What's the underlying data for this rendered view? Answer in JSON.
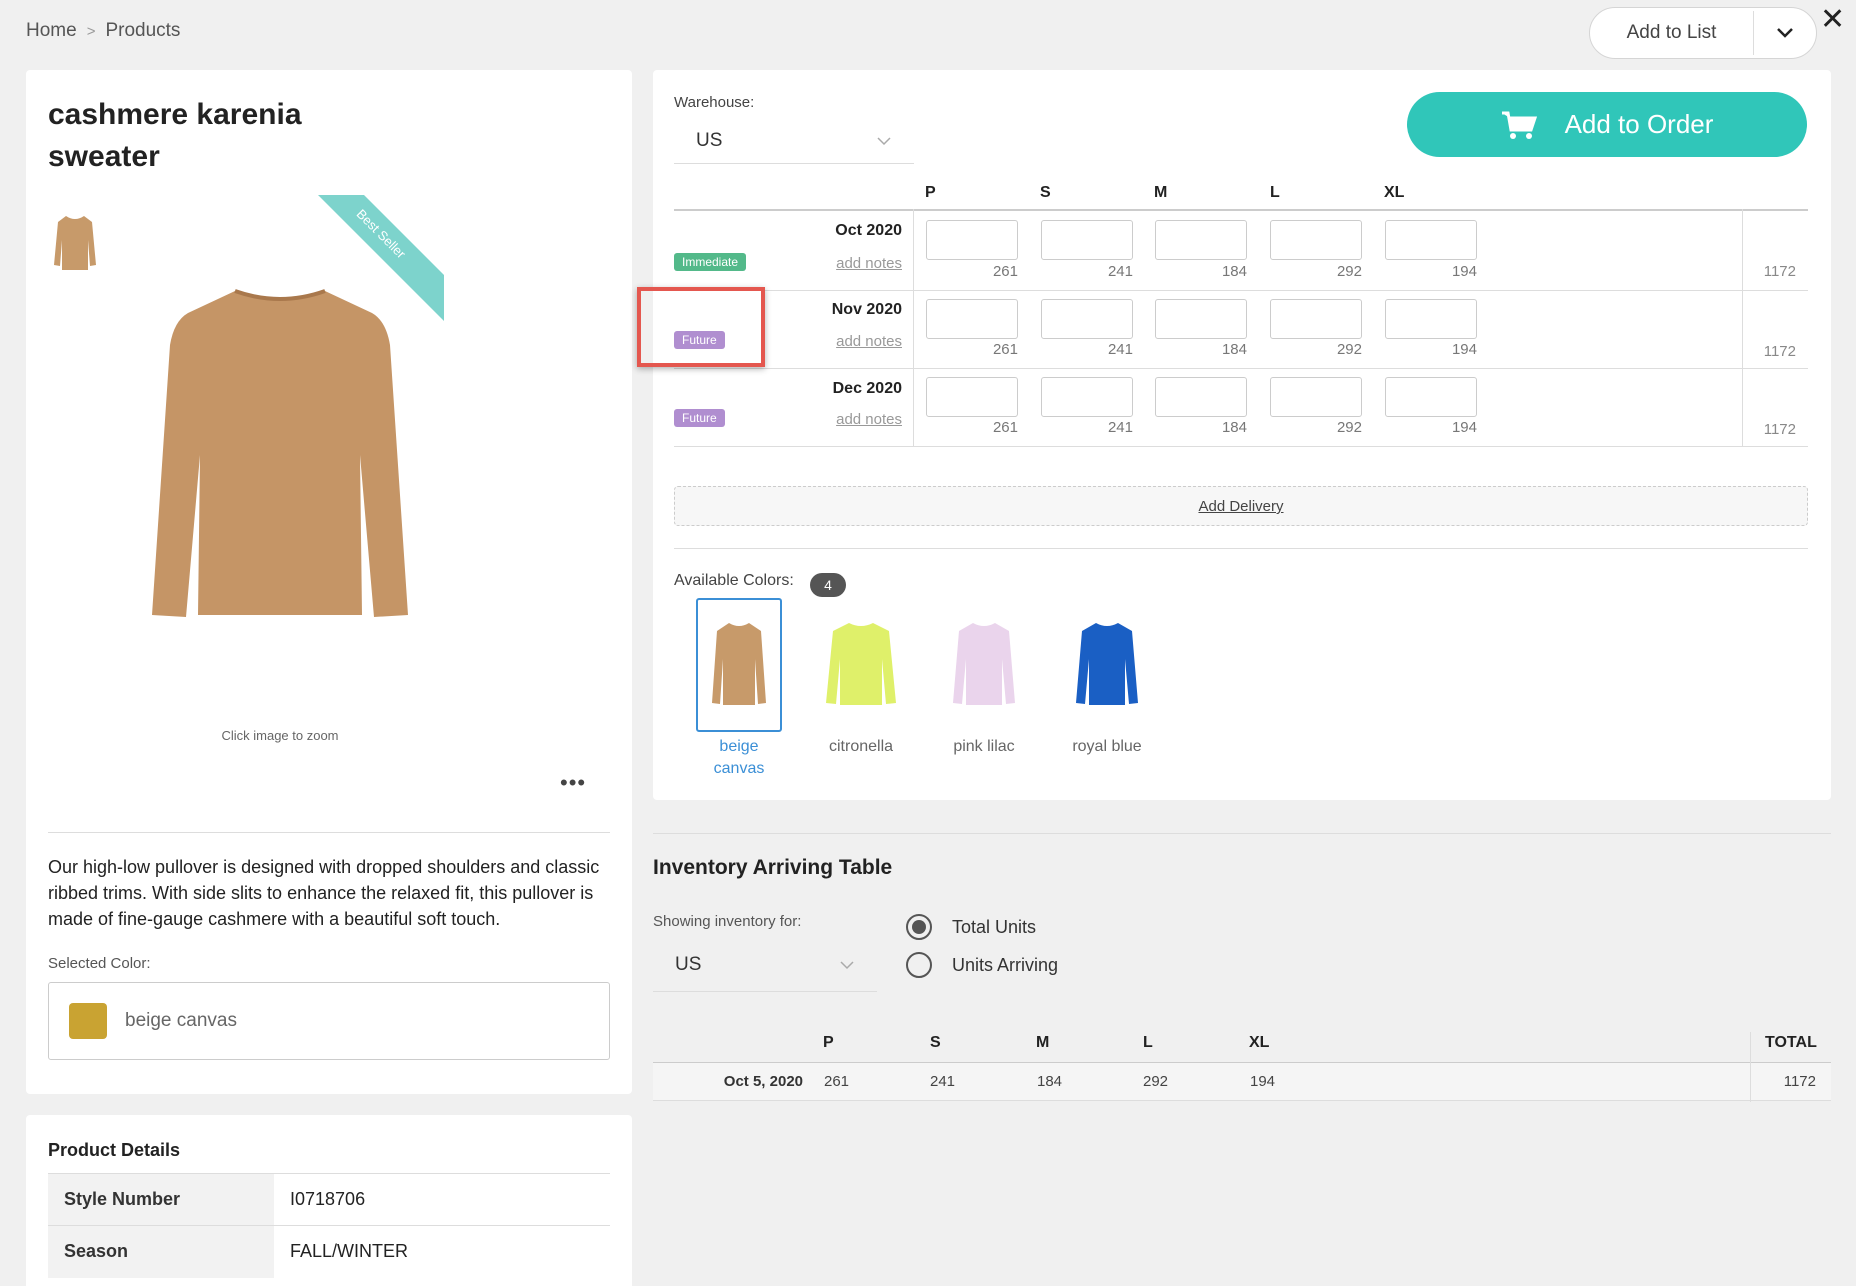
{
  "breadcrumb": {
    "home": "Home",
    "sep": ">",
    "current": "Products"
  },
  "header": {
    "add_to_list": "Add to List"
  },
  "product": {
    "title": "cashmere karenia\nsweater",
    "ribbon": "Best Seller",
    "zoom_hint": "Click image to zoom",
    "more": "•••",
    "description": "Our high-low pullover is designed with dropped shoulders and classic ribbed trims. With side slits to enhance the relaxed fit, this pullover is made of fine-gauge cashmere with a beautiful soft touch.",
    "selected_color_label": "Selected Color:",
    "selected_color": "beige canvas",
    "selected_color_hex": "#c9a332"
  },
  "details": {
    "title": "Product Details",
    "rows": [
      {
        "k": "Style Number",
        "v": "I0718706"
      },
      {
        "k": "Season",
        "v": "FALL/WINTER"
      }
    ]
  },
  "order": {
    "warehouse_label": "Warehouse:",
    "warehouse": "US",
    "add_to_order": "Add to Order",
    "sizes": [
      "P",
      "S",
      "M",
      "L",
      "XL"
    ],
    "deliveries": [
      {
        "badge": "Immediate",
        "date": "Oct 2020",
        "notes": "add notes",
        "avail": [
          "261",
          "241",
          "184",
          "292",
          "194"
        ],
        "total": "1172"
      },
      {
        "badge": "Future",
        "date": "Nov 2020",
        "notes": "add notes",
        "avail": [
          "261",
          "241",
          "184",
          "292",
          "194"
        ],
        "total": "1172"
      },
      {
        "badge": "Future",
        "date": "Dec 2020",
        "notes": "add notes",
        "avail": [
          "261",
          "241",
          "184",
          "292",
          "194"
        ],
        "total": "1172"
      }
    ],
    "add_delivery": "Add Delivery",
    "available_colors_label": "Available Colors:",
    "available_colors_count": "4",
    "colors": [
      {
        "name": "beige\ncanvas",
        "hex": "#c79a6a"
      },
      {
        "name": "citronella",
        "hex": "#dff06a"
      },
      {
        "name": "pink lilac",
        "hex": "#ead4ec"
      },
      {
        "name": "royal blue",
        "hex": "#1a5fc4"
      }
    ]
  },
  "inventory": {
    "title": "Inventory Arriving Table",
    "showing_label": "Showing inventory for:",
    "warehouse": "US",
    "options": [
      "Total Units",
      "Units Arriving"
    ],
    "selected_option": "Total Units",
    "headers": [
      "P",
      "S",
      "M",
      "L",
      "XL",
      "TOTAL"
    ],
    "row": {
      "date": "Oct 5, 2020",
      "values": [
        "261",
        "241",
        "184",
        "292",
        "194"
      ],
      "total": "1172"
    }
  },
  "colors": {
    "accent": "#30c6b9",
    "immediate": "#53b98a",
    "future": "#b08ed0",
    "highlight": "#e4574f",
    "selected": "#3b8fd6"
  }
}
